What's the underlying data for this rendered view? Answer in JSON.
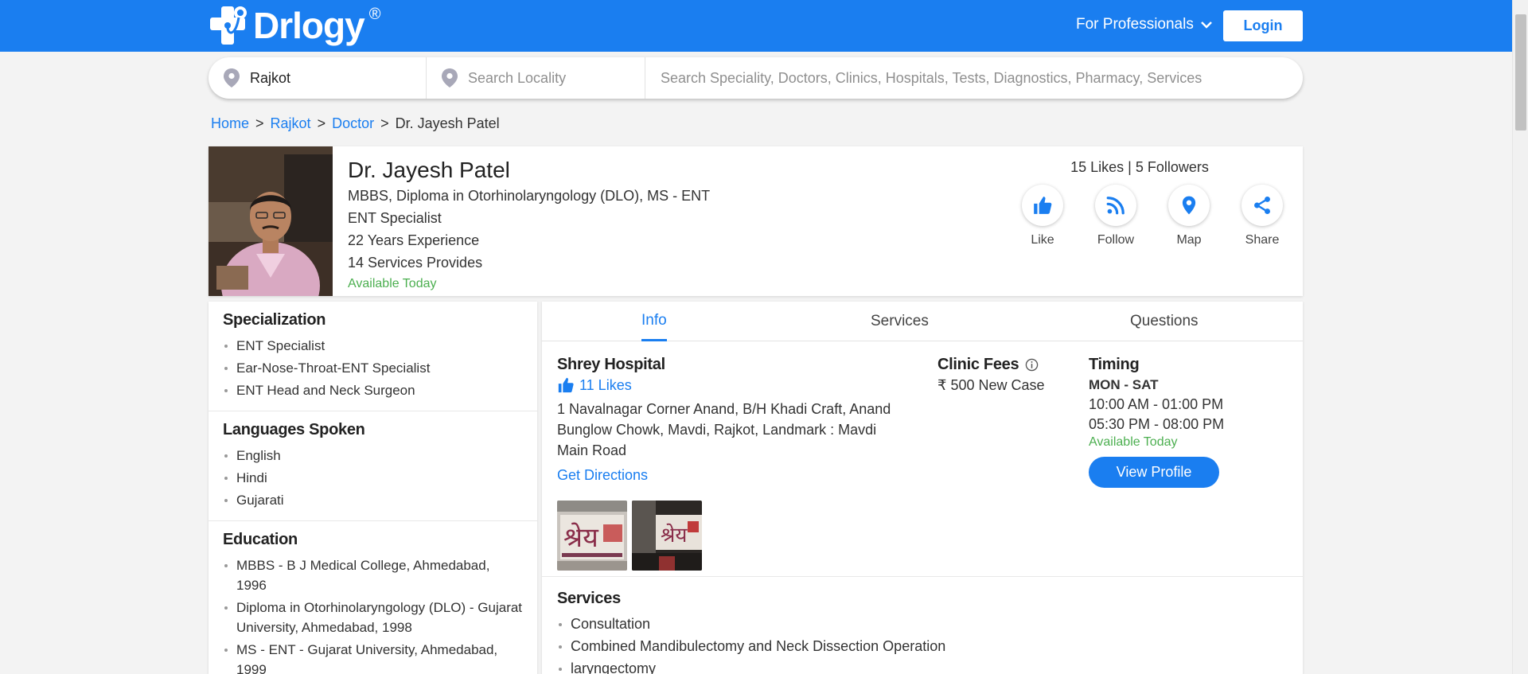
{
  "header": {
    "logo_text": "Drlogy",
    "logo_mark": "®",
    "for_professionals": "For Professionals",
    "login_label": "Login"
  },
  "search": {
    "city_value": "Rajkot",
    "locality_placeholder": "Search Locality",
    "query_placeholder": "Search Speciality, Doctors, Clinics, Hospitals, Tests, Diagnostics, Pharmacy, Services"
  },
  "breadcrumb": {
    "items": [
      "Home",
      "Rajkot",
      "Doctor"
    ],
    "separator": ">",
    "current": "Dr. Jayesh Patel"
  },
  "doctor": {
    "name": "Dr. Jayesh Patel",
    "degree": "MBBS, Diploma in Otorhinolaryngology (DLO), MS - ENT",
    "specialty": "ENT Specialist",
    "experience": "22 Years Experience",
    "services_count": "14 Services Provides",
    "availability": "Available Today",
    "stats": "15 Likes | 5 Followers",
    "actions": [
      {
        "label": "Like",
        "icon": "thumbs-up-icon"
      },
      {
        "label": "Follow",
        "icon": "rss-icon"
      },
      {
        "label": "Map",
        "icon": "map-pin-icon"
      },
      {
        "label": "Share",
        "icon": "share-icon"
      }
    ]
  },
  "sidebar": {
    "specialization": {
      "title": "Specialization",
      "items": [
        "ENT Specialist",
        "Ear-Nose-Throat-ENT Specialist",
        "ENT Head and Neck Surgeon"
      ]
    },
    "languages": {
      "title": "Languages Spoken",
      "items": [
        "English",
        "Hindi",
        "Gujarati"
      ]
    },
    "education": {
      "title": "Education",
      "items": [
        "MBBS - B J Medical College, Ahmedabad, 1996",
        "Diploma in Otorhinolaryngology (DLO) - Gujarat University, Ahmedabad, 1998",
        "MS - ENT - Gujarat University, Ahmedabad, 1999"
      ]
    }
  },
  "tabs": [
    "Info",
    "Services",
    "Questions"
  ],
  "clinic": {
    "name": "Shrey Hospital",
    "likes": "11 Likes",
    "address": "1 Navalnagar Corner Anand, B/H Khadi Craft, Anand Bunglow Chowk, Mavdi, Rajkot, Landmark : Mavdi Main Road",
    "directions": "Get Directions",
    "fees_title": "Clinic Fees",
    "fees_value": "₹ 500 New Case",
    "timing_title": "Timing",
    "timing_days": "MON - SAT",
    "timing_slots": [
      "10:00 AM - 01:00 PM",
      "05:30 PM - 08:00 PM"
    ],
    "timing_availability": "Available Today",
    "view_profile": "View Profile"
  },
  "services": {
    "title": "Services",
    "items": [
      "Consultation",
      "Combined Mandibulectomy and Neck Dissection Operation",
      "laryngectomy"
    ]
  },
  "colors": {
    "brand": "#1a7ef0",
    "available": "#4caf50"
  }
}
